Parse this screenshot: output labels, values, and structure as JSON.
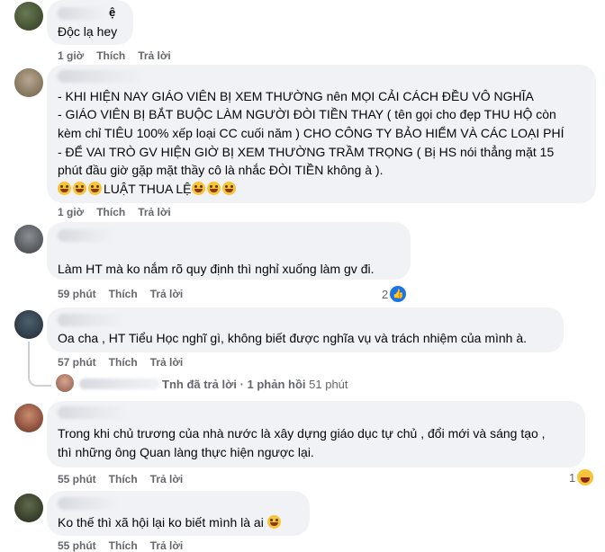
{
  "comments": [
    {
      "id": "c1",
      "name_fragment": "ệ",
      "lines": [
        "Độc lạ hey"
      ],
      "time": "1 giờ",
      "like": "Thích",
      "reply": "Trả lời"
    },
    {
      "id": "c2",
      "lines": [
        "- KHI HIỆN NAY GIÁO VIÊN BỊ XEM THƯỜNG nên MỌI CẢI CÁCH ĐỀU VÔ NGHĨA",
        "- GIÁO VIÊN BỊ BẮT BUỘC LÀM NGƯỜI ĐÒI TIỀN THAY ( tên gọi cho đẹp THU HỘ còn",
        "kèm chỉ TIÊU 100% xếp loại CC cuối năm ) CHO CÔNG TY BẢO HIỂM VÀ CÁC LOẠI PHÍ",
        "- ĐỂ VAI TRÒ GV HIỆN GIỜ BỊ XEM THƯỜNG TRẦM TRỌNG ( Bị HS nói thẳng mặt 15",
        "phút đầu giờ gặp mặt thầy cô là nhắc ĐÒI TIỀN không à )."
      ],
      "emoji_line_text": "LUẬT THUA LỆ",
      "time": "1 giờ",
      "like": "Thích",
      "reply": "Trả lời"
    },
    {
      "id": "c3",
      "lines": [
        "Làm HT mà ko nắm rõ quy định thì nghỉ xuống làm gv đi."
      ],
      "time": "59 phút",
      "like": "Thích",
      "reply": "Trả lời",
      "reaction_count": "2",
      "reaction_icon": "like-icon"
    },
    {
      "id": "c4",
      "lines": [
        "Oa cha , HT Tiểu Học nghĩ gì, không biết được nghĩa vụ và trách nhiệm của mình à."
      ],
      "time": "57 phút",
      "like": "Thích",
      "reply": "Trả lời",
      "replies_summary": {
        "name_fragment": "T",
        "replied": "nh đã trả lời",
        "count": "· 1 phản hồi",
        "time": "51 phút"
      }
    },
    {
      "id": "c5",
      "lines": [
        "Trong khi chủ trương của nhà nước là xây dựng giáo dục tự chủ , đổi mới và sáng tạo ,",
        "thì những ông Quan làng thực hiện ngược lại."
      ],
      "time": "55 phút",
      "like": "Thích",
      "reply": "Trả lời",
      "reaction_count": "1",
      "reaction_icon": "haha-icon"
    },
    {
      "id": "c6",
      "lines": [
        "Ko thế thì xã hội lại ko biết mình là ai"
      ],
      "time": "55 phút",
      "like": "Thích",
      "reply": "Trả lời"
    }
  ],
  "colors": {
    "bubble": "#f0f2f5",
    "meta_text": "#65676b",
    "like_blue": "#1b74e4"
  }
}
